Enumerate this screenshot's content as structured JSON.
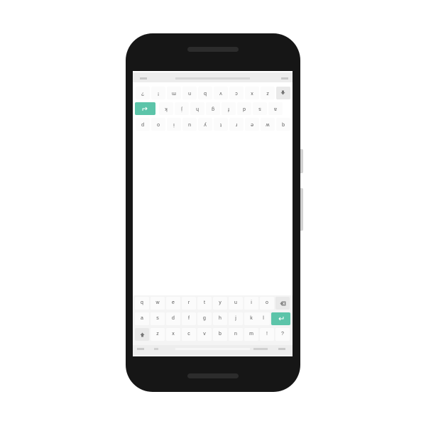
{
  "keyboard": {
    "row1": [
      "q",
      "w",
      "e",
      "r",
      "t",
      "y",
      "u",
      "i",
      "o",
      "p"
    ],
    "row2": [
      "a",
      "s",
      "d",
      "f",
      "g",
      "h",
      "j",
      "k",
      "l"
    ],
    "row3": [
      "z",
      "x",
      "c",
      "v",
      "b",
      "n",
      "m",
      "!",
      "?"
    ],
    "backspace_icon": "backspace-icon",
    "enter_icon": "enter-arrow-icon",
    "shift_icon": "shift-icon",
    "accent_color": "#5cc4a9"
  }
}
